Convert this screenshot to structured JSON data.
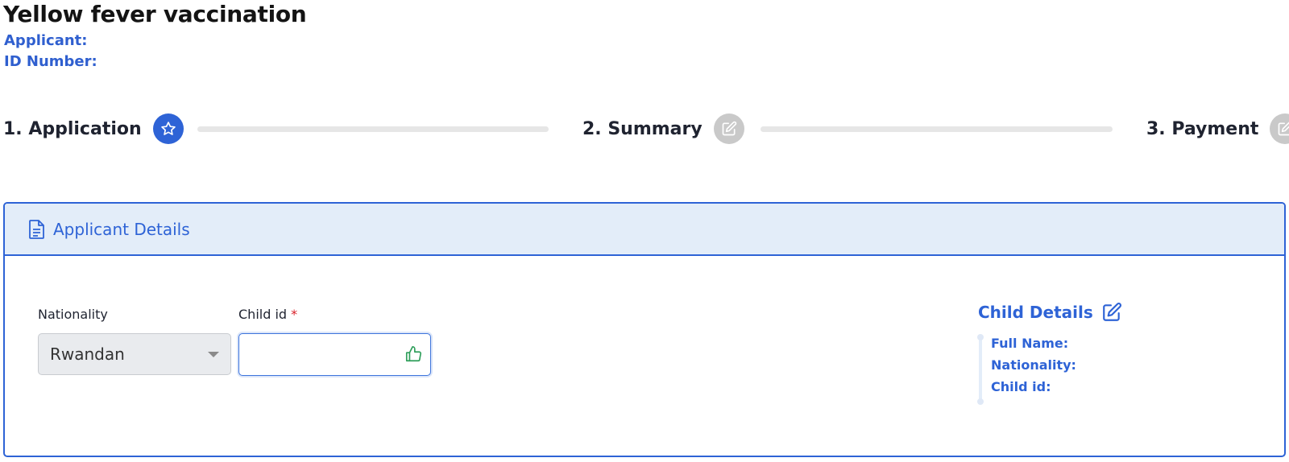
{
  "header": {
    "title": "Yellow fever vaccination",
    "applicant_label": "Applicant:",
    "id_number_label": "ID Number:"
  },
  "stepper": {
    "steps": [
      {
        "label": "1. Application",
        "icon": "star-icon",
        "state": "active"
      },
      {
        "label": "2. Summary",
        "icon": "edit-icon",
        "state": "inactive"
      },
      {
        "label": "3. Payment",
        "icon": "edit-icon",
        "state": "inactive"
      }
    ]
  },
  "card": {
    "title": "Applicant Details",
    "icon": "document-icon",
    "nationality": {
      "label": "Nationality",
      "selected": "Rwandan"
    },
    "child_id": {
      "label": "Child id",
      "required_mark": "*",
      "value": "",
      "placeholder": ""
    },
    "child_details": {
      "title": "Child Details",
      "items": [
        "Full Name:",
        "Nationality:",
        "Child id:"
      ]
    }
  },
  "colors": {
    "accent": "#2e63d6",
    "header_bg": "#e3edf9",
    "inactive_step": "#c9c9c9",
    "success": "#2e9e5a",
    "required": "#d9222a"
  }
}
